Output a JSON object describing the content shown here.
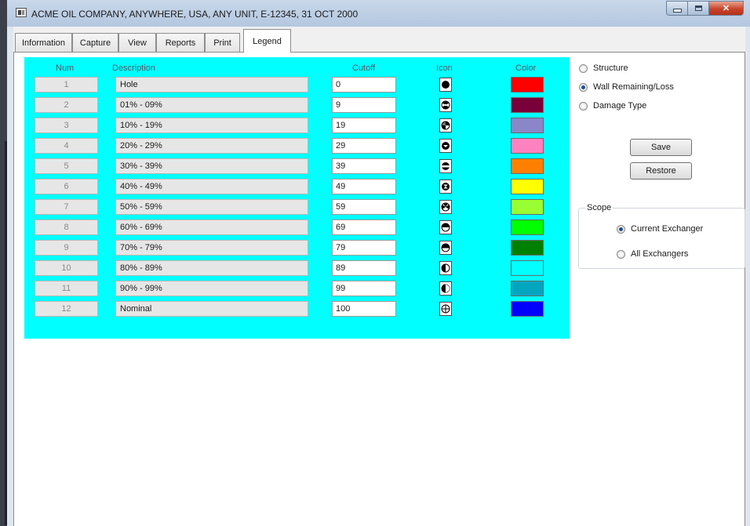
{
  "window": {
    "title": "ACME OIL COMPANY, ANYWHERE, USA, ANY UNIT, E-12345, 31 OCT 2000"
  },
  "tabs": [
    {
      "label": "Information"
    },
    {
      "label": "Capture"
    },
    {
      "label": "View"
    },
    {
      "label": "Reports"
    },
    {
      "label": "Print"
    },
    {
      "label": "Legend",
      "active": true
    }
  ],
  "legend": {
    "panel_color": "#00ffff",
    "headers": {
      "num": "Num",
      "description": "Description",
      "cutoff": "Cutoff",
      "icon": "Icon",
      "color": "Color"
    },
    "rows": [
      {
        "num": "1",
        "description": "Hole",
        "cutoff": "0",
        "icon": "solid-circle-icon",
        "color": "#ff0000"
      },
      {
        "num": "2",
        "description": "01% - 09%",
        "cutoff": "9",
        "icon": "radiation-icon",
        "color": "#7a0039"
      },
      {
        "num": "3",
        "description": "10% - 19%",
        "cutoff": "19",
        "icon": "quad-wedge-icon",
        "color": "#8a86c8"
      },
      {
        "num": "4",
        "description": "20% - 29%",
        "cutoff": "29",
        "icon": "circle-bottom-notch-icon",
        "color": "#ff82c0"
      },
      {
        "num": "5",
        "description": "30% - 39%",
        "cutoff": "39",
        "icon": "circle-top-band-icon",
        "color": "#ff8000"
      },
      {
        "num": "6",
        "description": "40% - 49%",
        "cutoff": "49",
        "icon": "hourglass-circle-icon",
        "color": "#ffff00"
      },
      {
        "num": "7",
        "description": "50% - 59%",
        "cutoff": "59",
        "icon": "bowtie-circle-icon",
        "color": "#99ff33"
      },
      {
        "num": "8",
        "description": "60% - 69%",
        "cutoff": "69",
        "icon": "half-bottom-circle-icon",
        "color": "#00ff00"
      },
      {
        "num": "9",
        "description": "70% - 79%",
        "cutoff": "79",
        "icon": "half-top-circle-icon",
        "color": "#008000"
      },
      {
        "num": "10",
        "description": "80% - 89%",
        "cutoff": "89",
        "icon": "half-right-circle-icon",
        "color": "#00ffff"
      },
      {
        "num": "11",
        "description": "90% - 99%",
        "cutoff": "99",
        "icon": "half-left-circle-icon",
        "color": "#00a6bf"
      },
      {
        "num": "12",
        "description": "Nominal",
        "cutoff": "100",
        "icon": "crosshair-circle-icon",
        "color": "#0000ff"
      }
    ]
  },
  "mode": {
    "options": [
      {
        "label": "Structure",
        "checked": false
      },
      {
        "label": "Wall Remaining/Loss",
        "checked": true
      },
      {
        "label": "Damage Type",
        "checked": false
      }
    ]
  },
  "buttons": {
    "save": "Save",
    "restore": "Restore"
  },
  "scope": {
    "title": "Scope",
    "options": [
      {
        "label": "Current Exchanger",
        "checked": true
      },
      {
        "label": "All Exchangers",
        "checked": false
      }
    ]
  }
}
